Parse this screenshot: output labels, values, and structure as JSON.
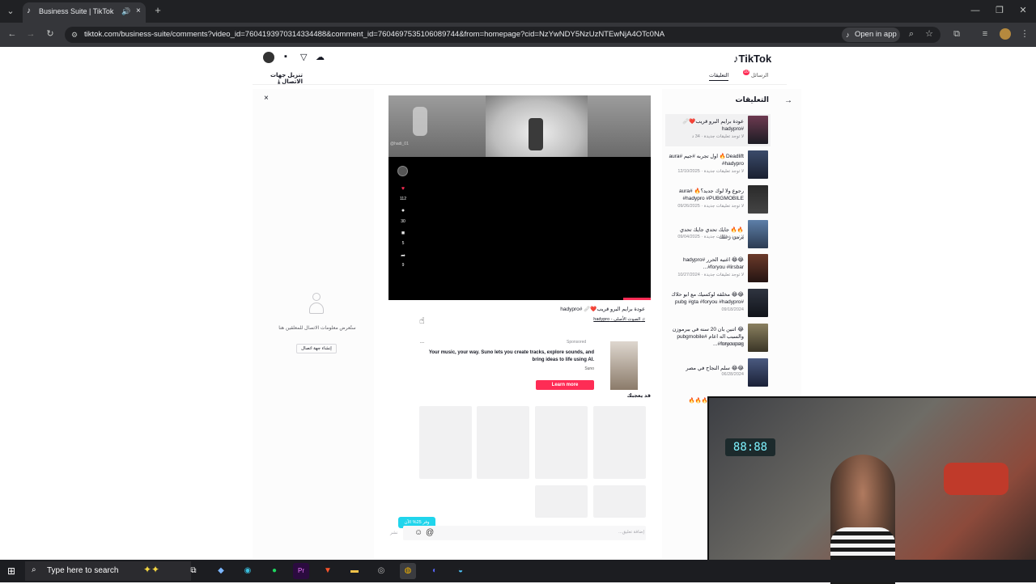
{
  "browser": {
    "tab_title": "Business Suite | TikTok",
    "url": "tiktok.com/business-suite/comments?video_id=7604193970314334488&comment_id=7604697535106089744&from=homepage?cid=NzYwNDY5NzUzNTEwNjA4OTc0NA",
    "open_in_app": "Open in app",
    "new_tab": "+",
    "tab_close": "×",
    "controls": {
      "minimize": "—",
      "restore": "❐",
      "close": "✕"
    }
  },
  "header": {
    "brand": "TikTok",
    "nav": [
      {
        "label": "التعليقات"
      },
      {
        "label": "الرسائل",
        "badge": "10"
      }
    ],
    "download_contact": "تنزيل جهات الاتصال"
  },
  "comments_panel": {
    "title": "التعليقات",
    "items": [
      {
        "text": "عودة برايم البرو قريب❤️🩹 #hadypro",
        "meta": "لا توجد تعليقات جديدة · 34 د"
      },
      {
        "text": "Deadlift🔥 اول تجربه #جيم #aura #hadypro",
        "meta": "لا توجد تعليقات جديدة · 12/10/2025"
      },
      {
        "text": "رجوع ولا لوك جديد؟🔥 #aura #hadypro #PUBGMOBILE",
        "meta": "لا توجد تعليقات جديدة · 09/26/2025"
      },
      {
        "text": "🔥🔥 جايك تحدي جايك تحدي يرمي زعلك",
        "meta": "لا توجد تعليقات جديدة · 09/04/2025"
      },
      {
        "text": "😂😂 اغنيه الحرر #hadypro #foryou #lirsbar...",
        "meta": "لا توجد تعليقات جديدة · 10/27/2024"
      },
      {
        "text": "😂😂 مخلقه لوكسيك مع ابو حلاك #pubg #gta #foryou #hadypro",
        "meta": "09/18/2024"
      },
      {
        "text": "😂 اتنين بان 20 سنه في ببرموزن والسبب اله اعام #pubgmobile #foryoupag...",
        "meta": "09/13/2024"
      },
      {
        "text": "😂😂 سلم النجاح في مصر",
        "meta": "06/28/2024"
      },
      {
        "text": "🔥🔥🔥",
        "meta": ""
      }
    ]
  },
  "video": {
    "watermark": "@hadi_01",
    "likes": "112",
    "comments": "30",
    "saves": "5",
    "shares": "9",
    "caption": "عودة برايم البرو قريب❤️🩹 #hadypro",
    "sound": "الصوت الأصلي - hadypro"
  },
  "ad": {
    "sponsored": "Sponsored",
    "more": "...",
    "text": "Your music, your way. Suno lets you create tracks, explore sounds, and bring ideas to life using AI.",
    "brand": "Suno",
    "cta": "Learn more"
  },
  "you_may_like": "قد يعجبك",
  "contact_panel": {
    "close": "×",
    "empty": "ستُعرض معلومات الاتصال للمعلقين هنا",
    "create": "إنشاء جهة اتصال"
  },
  "composer": {
    "placeholder": "إضافة تعليق...",
    "post": "نشر",
    "at": "@",
    "emoji": "☺",
    "promo": "وفر 25% الآن"
  },
  "taskbar": {
    "search": "Type here to search"
  },
  "colors": {
    "accent": "#fe2c55",
    "teal": "#20d5ec",
    "chrome_dark": "#202124"
  }
}
